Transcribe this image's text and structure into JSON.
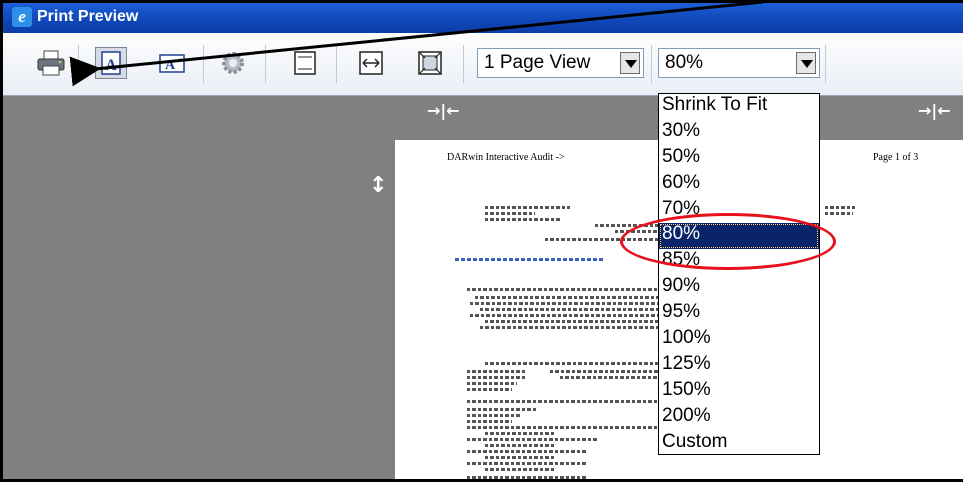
{
  "window": {
    "title": "Print Preview",
    "icon": "ie-icon"
  },
  "toolbar": {
    "buttons": [
      {
        "name": "print-button",
        "icon": "printer-icon"
      },
      {
        "name": "portrait-button",
        "icon": "portrait-icon",
        "glyph": "A"
      },
      {
        "name": "landscape-button",
        "icon": "landscape-icon",
        "glyph": "A"
      },
      {
        "name": "page-setup-button",
        "icon": "gear-icon"
      },
      {
        "name": "headers-footers-button",
        "icon": "header-footer-icon"
      },
      {
        "name": "full-width-button",
        "icon": "full-width-icon"
      },
      {
        "name": "full-page-button",
        "icon": "full-page-icon"
      }
    ],
    "view_select": {
      "value": "1 Page View"
    },
    "zoom_select": {
      "value": "80%"
    }
  },
  "zoom_dropdown": {
    "options": [
      "Shrink To Fit",
      "30%",
      "50%",
      "60%",
      "70%",
      "80%",
      "85%",
      "90%",
      "95%",
      "100%",
      "125%",
      "150%",
      "200%",
      "Custom"
    ],
    "selected": "80%"
  },
  "page": {
    "header_left": "DARwin Interactive Audit ->",
    "header_right": "Page 1 of 3"
  },
  "icons": {
    "margin_handle_h": "→|←",
    "margin_handle_v": "↕"
  },
  "colors": {
    "title_bar": "#0f46b8",
    "highlight": "#0a246a",
    "annotation": "#e8101b"
  }
}
